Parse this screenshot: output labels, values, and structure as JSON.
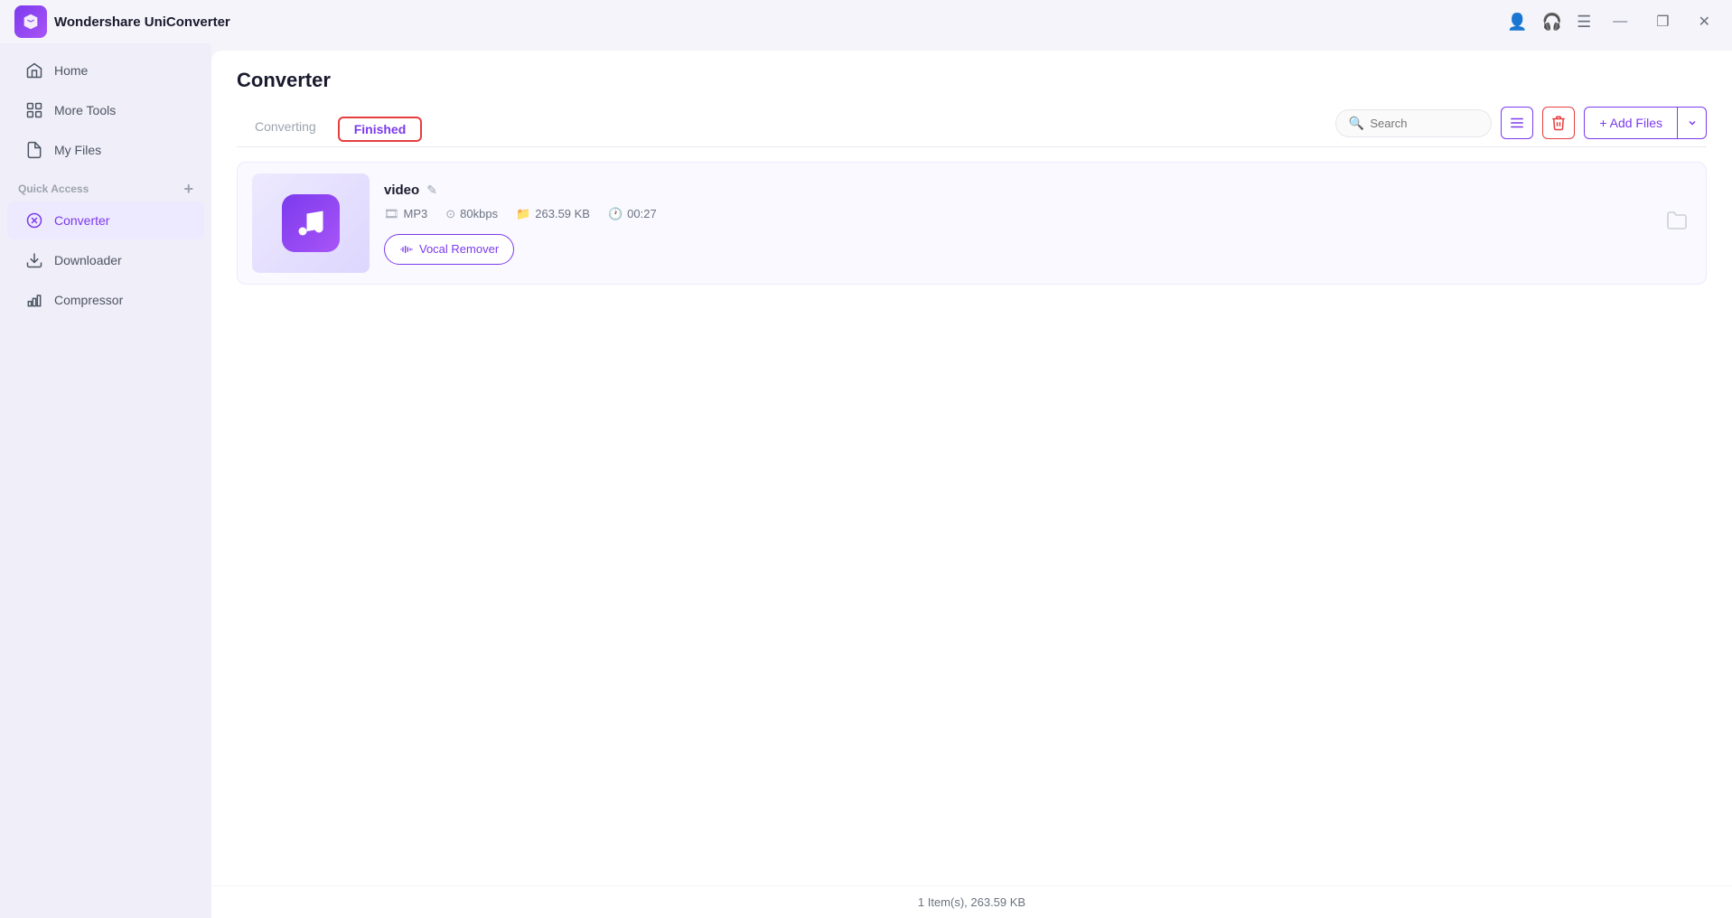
{
  "app": {
    "name": "Wondershare UniConverter",
    "logo_alt": "UniConverter logo"
  },
  "titlebar": {
    "icons": {
      "profile": "👤",
      "headset": "🎧",
      "menu": "☰",
      "minimize": "—",
      "restore": "❐",
      "close": "✕"
    }
  },
  "sidebar": {
    "items": [
      {
        "id": "home",
        "label": "Home",
        "icon": "home"
      },
      {
        "id": "more-tools",
        "label": "More Tools",
        "icon": "tools"
      },
      {
        "id": "my-files",
        "label": "My Files",
        "icon": "files"
      }
    ],
    "quick_access_label": "Quick Access",
    "quick_access_add": "+",
    "quick_access_items": [
      {
        "id": "converter",
        "label": "Converter",
        "icon": "converter",
        "active": true
      },
      {
        "id": "downloader",
        "label": "Downloader",
        "icon": "downloader"
      },
      {
        "id": "compressor",
        "label": "Compressor",
        "icon": "compressor"
      }
    ]
  },
  "page": {
    "title": "Converter",
    "tabs": [
      {
        "id": "converting",
        "label": "Converting",
        "active": false
      },
      {
        "id": "finished",
        "label": "Finished",
        "active": true
      }
    ]
  },
  "toolbar": {
    "search_placeholder": "Search",
    "list_view_icon": "list",
    "delete_icon": "🗑",
    "add_files_label": "+ Add Files",
    "dropdown_icon": "▾"
  },
  "files": [
    {
      "name": "video",
      "format": "MP3",
      "bitrate": "80kbps",
      "size": "263.59 KB",
      "duration": "00:27",
      "vocal_remover_label": "Vocal Remover"
    }
  ],
  "status_bar": {
    "text": "1 Item(s), 263.59 KB"
  }
}
